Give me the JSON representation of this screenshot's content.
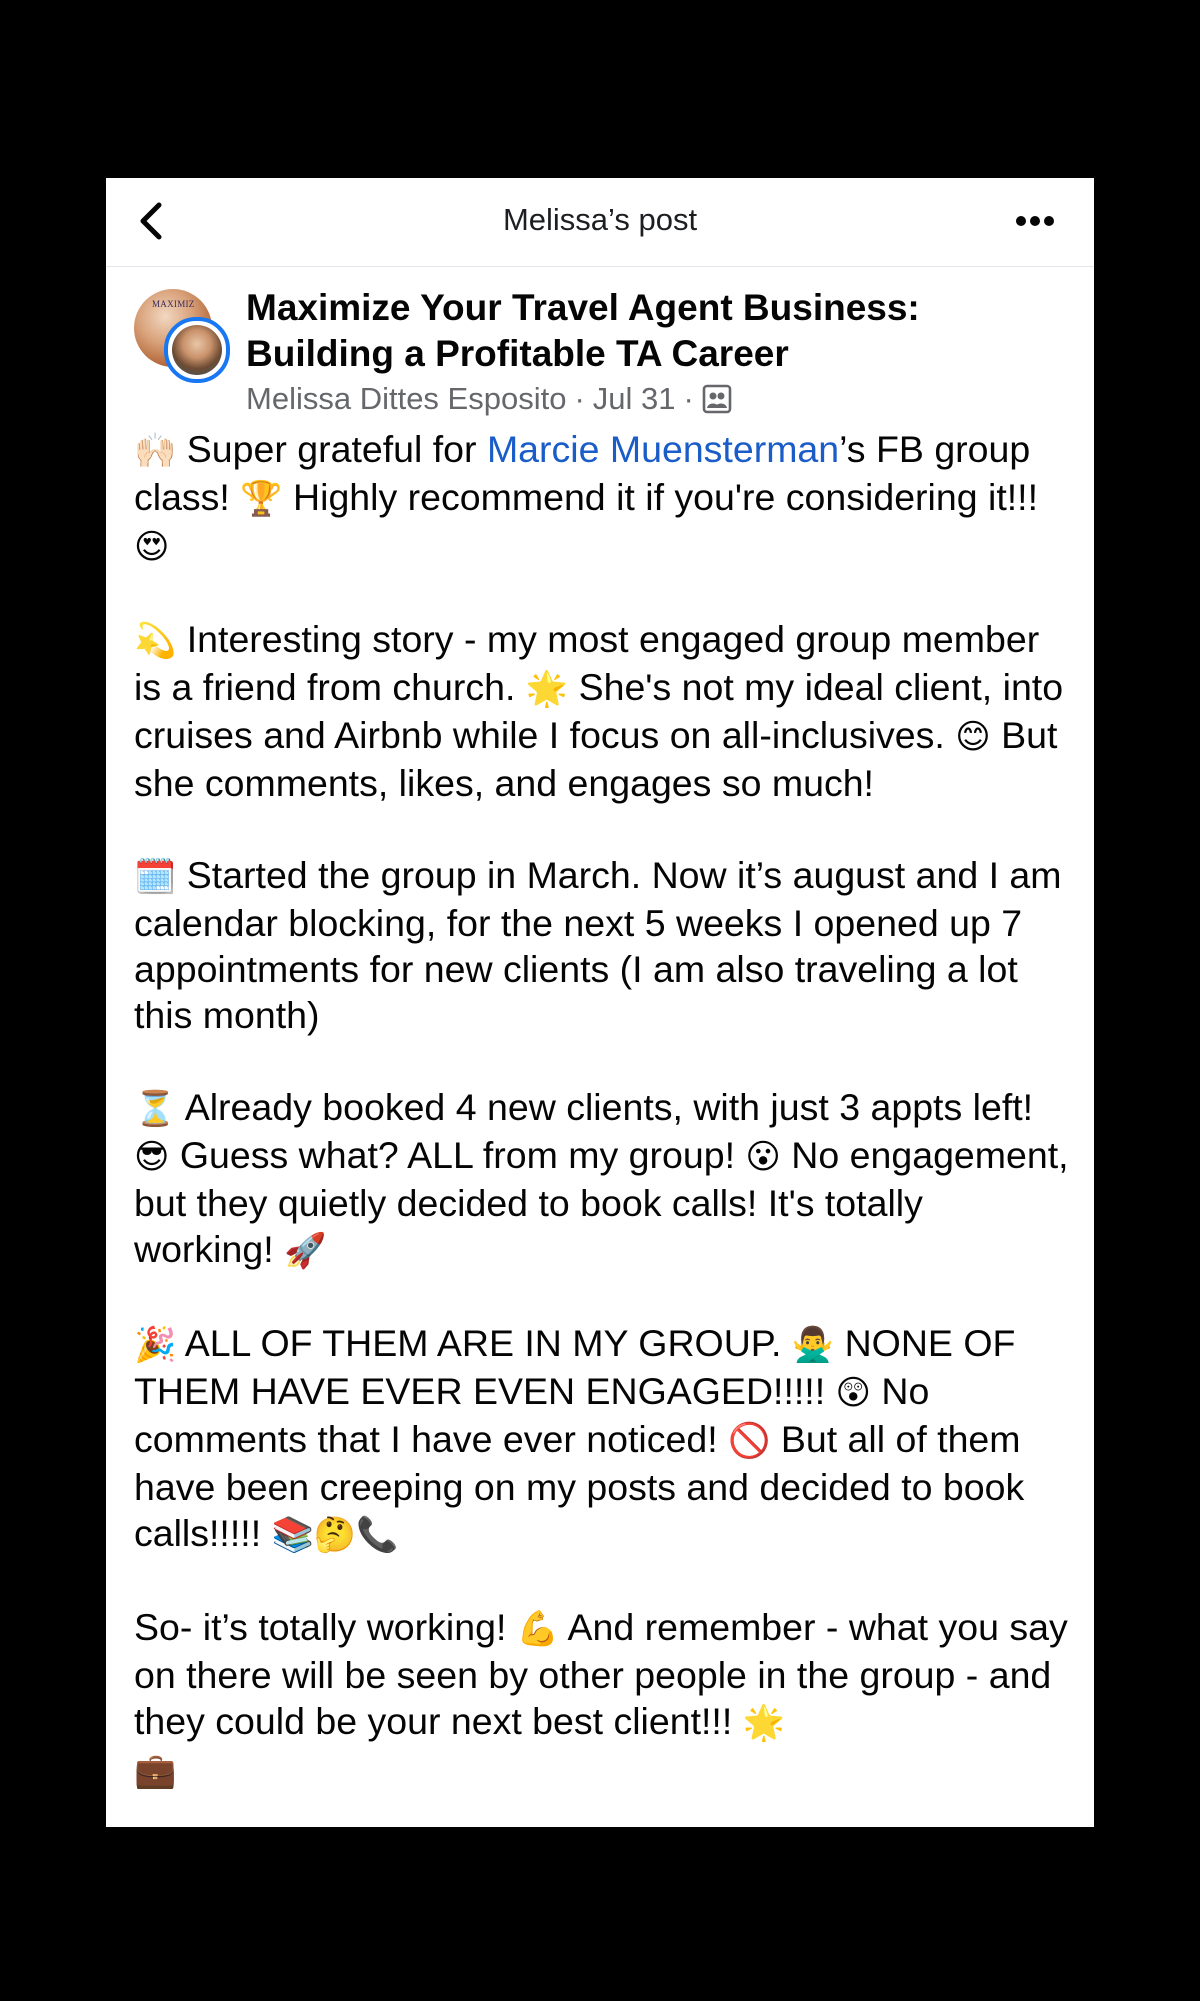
{
  "topbar": {
    "title": "Melissa’s post",
    "back_icon": "chevron-left-icon",
    "more_icon": "more-horizontal-icon"
  },
  "post": {
    "group_avatar_text": "MAXIMIZ",
    "group_name": "Maximize Your Travel Agent Business: Building a Profitable TA Career",
    "author": "Melissa Dittes Esposito",
    "separator": "·",
    "date": "Jul 31",
    "privacy_icon": "group-members-icon",
    "paragraphs": [
      {
        "e1": "🙌🏻",
        "t1": " Super grateful for ",
        "mention": "Marcie Muensterman",
        "t2": "’s FB group class! ",
        "e2": "🏆",
        "t3": " Highly recommend it if you're considering it!!! ",
        "e3": "😍"
      },
      {
        "e1": "💫",
        "t1": " Interesting story - my most engaged group member is a friend from church. ",
        "e2": "🌟",
        "t2": " She's not my ideal client, into cruises and Airbnb while I focus on all-inclusives. ",
        "e3": "😊",
        "t3": " But she comments, likes, and engages so much!"
      },
      {
        "e1": "🗓️",
        "t1": " Started the group in March.   Now it’s august and I am calendar blocking, for the next 5 weeks I opened up 7 appointments for new clients (I am also traveling a lot this month)"
      },
      {
        "e1": "⏳",
        "t1": " Already booked 4 new clients, with just 3 appts left! ",
        "e2": "😎",
        "t2": " Guess what? ALL from my group! ",
        "e3": "😮",
        "t3": " No engagement, but they quietly decided to book calls! It's totally working! ",
        "e4": "🚀"
      },
      {
        "e1": "🎉",
        "t1": " ALL OF THEM ARE IN MY GROUP. ",
        "e2": "🙅‍♂️",
        "t2": " NONE OF THEM HAVE EVER EVEN ENGAGED!!!!! ",
        "e3": "😲",
        "t3": " No comments that I have ever noticed! ",
        "e4": "🚫",
        "t4": " But all of them have been creeping on my posts and decided to book calls!!!!! ",
        "e5": "📚🤔📞"
      },
      {
        "t1": "So- it’s totally working! ",
        "e1": "💪",
        "t2": " And remember - what you say on there will be seen by other people in the group - and they could be your next best client!!! ",
        "e2": "🌟",
        "e3": "💼"
      }
    ]
  },
  "colors": {
    "background": "#000000",
    "card": "#ffffff",
    "link": "#1a5cc8",
    "meta": "#65676b",
    "avatar_ring": "#1877f2"
  }
}
